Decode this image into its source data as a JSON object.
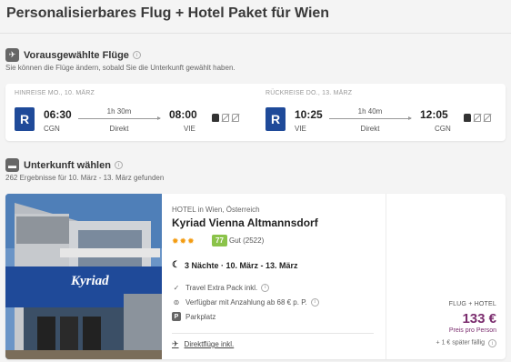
{
  "page": {
    "title": "Personalisierbares Flug + Hotel Paket für Wien"
  },
  "flights_section": {
    "title": "Vorausgewählte Flüge",
    "subtitle": "Sie können die Flüge ändern, sobald Sie die Unterkunft gewählt haben.",
    "outbound": {
      "label": "HINREISE MO., 10. MÄRZ",
      "airline": "R",
      "dep_time": "06:30",
      "dep_code": "CGN",
      "duration": "1h 30m",
      "stops": "Direkt",
      "arr_time": "08:00",
      "arr_code": "VIE"
    },
    "return": {
      "label": "RÜCKREISE DO., 13. MÄRZ",
      "airline": "R",
      "dep_time": "10:25",
      "dep_code": "VIE",
      "duration": "1h 40m",
      "stops": "Direkt",
      "arr_time": "12:05",
      "arr_code": "CGN"
    }
  },
  "hotel_section": {
    "title": "Unterkunft wählen",
    "subtitle": "262 Ergebnisse für 10. März - 13. März gefunden"
  },
  "hotel": {
    "location": "HOTEL in Wien, Österreich",
    "name": "Kyriad Vienna Altmannsdorf",
    "stars": "✹✹✹",
    "score": "77",
    "grade": "Gut (2522)",
    "nights": "3 Nächte · 10. März - 13. März",
    "features": [
      "Travel Extra Pack inkl.",
      "Verfügbar mit Anzahlung ab 68 € p. P.",
      "Parkplatz"
    ],
    "direct_flights": "Direktflüge inkl.",
    "sign": "Kyriad",
    "package_label": "FLUG + HOTEL",
    "price": "133 €",
    "price_note": "Preis pro Person",
    "later_fee": "+ 1 € später fällig"
  },
  "colors": {
    "airline": "#1f4a99",
    "price": "#7b2d6e",
    "score": "#8bc34a",
    "stars": "#f39c12"
  }
}
